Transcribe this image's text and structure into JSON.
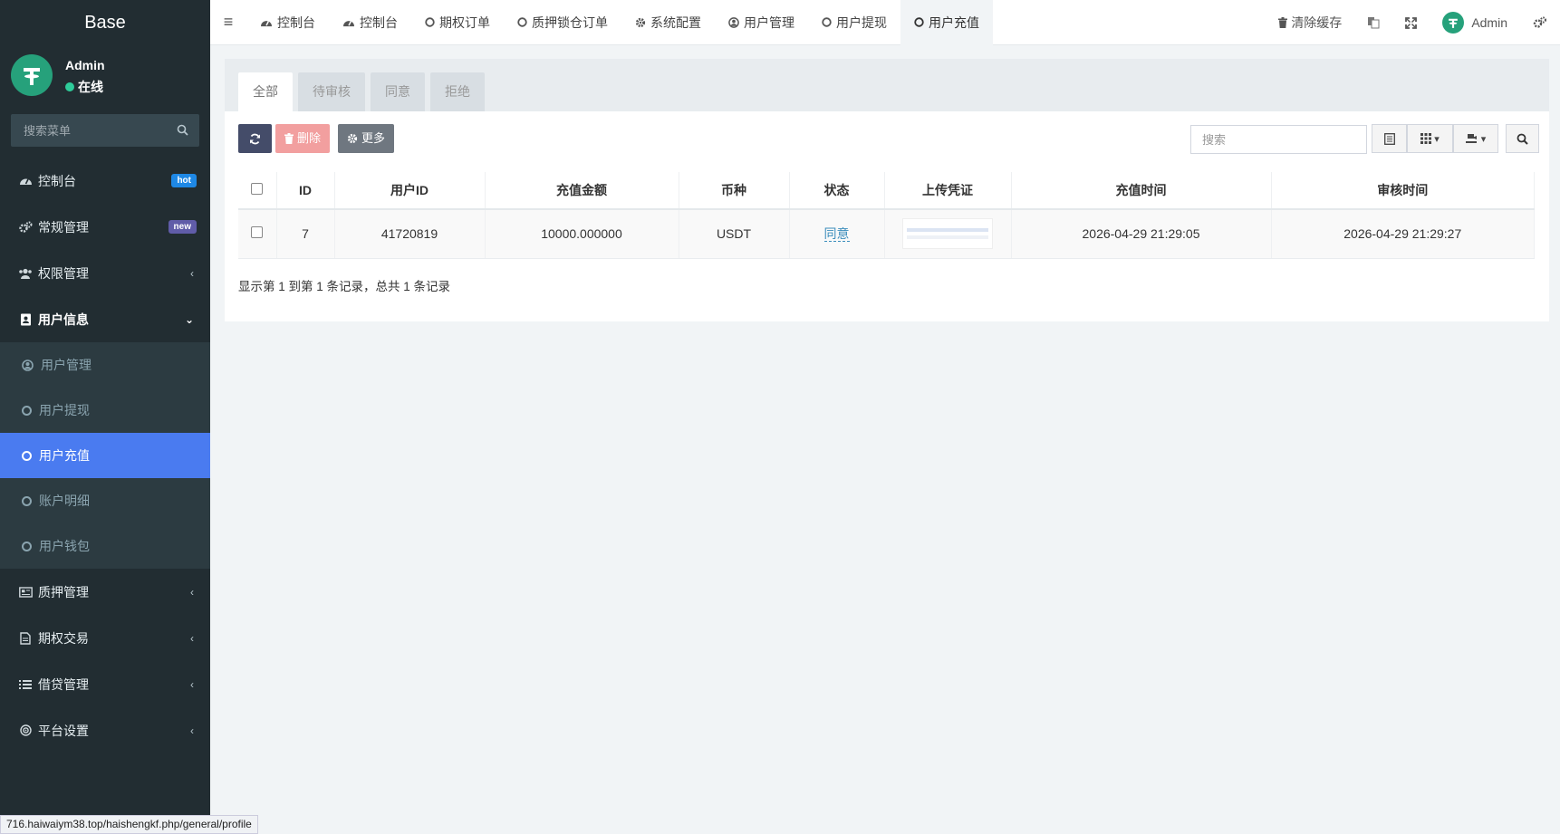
{
  "brand": "Base",
  "user": {
    "name": "Admin",
    "status": "在线"
  },
  "sidebar": {
    "search_placeholder": "搜索菜单",
    "items": [
      {
        "label": "控制台",
        "badge": "hot",
        "badge_color": "#1e88e5"
      },
      {
        "label": "常规管理",
        "badge": "new",
        "badge_color": "#605ca8"
      },
      {
        "label": "权限管理"
      },
      {
        "label": "用户信息"
      },
      {
        "label": "质押管理"
      },
      {
        "label": "期权交易"
      },
      {
        "label": "借贷管理"
      },
      {
        "label": "平台设置"
      }
    ],
    "submenu": [
      {
        "label": "用户管理"
      },
      {
        "label": "用户提现"
      },
      {
        "label": "用户充值"
      },
      {
        "label": "账户明细"
      },
      {
        "label": "用户钱包"
      }
    ]
  },
  "topnav": {
    "tabs": [
      {
        "label": "控制台"
      },
      {
        "label": "控制台"
      },
      {
        "label": "期权订单"
      },
      {
        "label": "质押锁仓订单"
      },
      {
        "label": "系统配置"
      },
      {
        "label": "用户管理"
      },
      {
        "label": "用户提现"
      },
      {
        "label": "用户充值"
      }
    ],
    "clear_cache": "清除缓存",
    "admin": "Admin"
  },
  "content": {
    "filter_tabs": [
      "全部",
      "待审核",
      "同意",
      "拒绝"
    ],
    "toolbar": {
      "delete_label": "删除",
      "more_label": "更多",
      "search_placeholder": "搜索"
    },
    "columns": [
      "ID",
      "用户ID",
      "充值金额",
      "币种",
      "状态",
      "上传凭证",
      "充值时间",
      "审核时间"
    ],
    "rows": [
      {
        "id": "7",
        "user_id": "41720819",
        "amount": "10000.000000",
        "currency": "USDT",
        "status": "同意",
        "created": "2026-04-29 21:29:05",
        "reviewed": "2026-04-29 21:29:27"
      }
    ],
    "pagination": "显示第 1 到第 1 条记录，总共 1 条记录"
  },
  "statusbar": "716.haiwaiym38.top/haishengkf.php/general/profile",
  "colors": {
    "sidebar_bg": "#222d32",
    "active_menu": "#4a7bf0",
    "brand_green": "#26a17b"
  }
}
